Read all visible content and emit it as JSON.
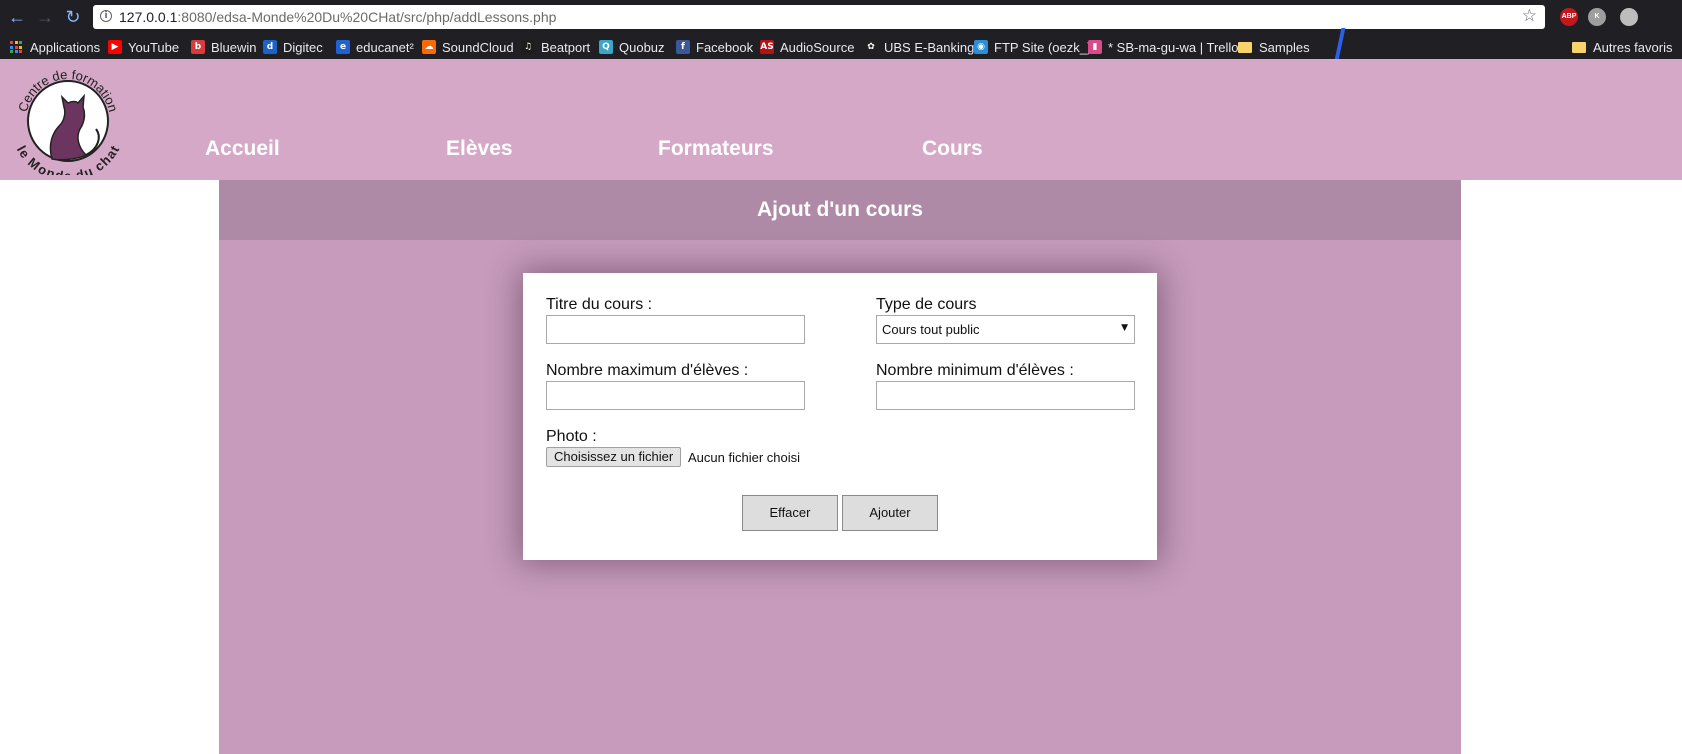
{
  "browser": {
    "url_host": "127.0.0.1",
    "url_rest": ":8080/edsa-Monde%20Du%20CHat/src/php/addLessons.php",
    "info_glyph": "i",
    "extensions": [
      {
        "name": "adblock-plus-icon",
        "text": "ABP",
        "color": "#c4161c"
      },
      {
        "name": "k-extension-icon",
        "text": "K",
        "color": "#9e9e9e"
      },
      {
        "name": "ghost-extension-icon",
        "text": "",
        "color": "#bdbdbd"
      }
    ],
    "bookmarks": [
      {
        "label": "Applications"
      },
      {
        "label": "YouTube",
        "icon": "youtube-icon",
        "color": "#ff0000",
        "glyph": "▶"
      },
      {
        "label": "Bluewin",
        "icon": "bluewin-icon",
        "color": "#d83b3b",
        "glyph": "b"
      },
      {
        "label": "Digitec",
        "icon": "digitec-icon",
        "color": "#1b63c6",
        "glyph": "d"
      },
      {
        "label": "educanet²",
        "icon": "educanet-icon",
        "color": "#1e63d1",
        "glyph": "e"
      },
      {
        "label": "SoundCloud",
        "icon": "soundcloud-icon",
        "color": "#ff6a00",
        "glyph": "☁"
      },
      {
        "label": "Beatport",
        "icon": "beatport-icon",
        "color": "#1d1d1d",
        "glyph": "♫"
      },
      {
        "label": "Quobuz",
        "icon": "quobuz-icon",
        "color": "#3aa5c6",
        "glyph": "Q"
      },
      {
        "label": "Facebook",
        "icon": "facebook-icon",
        "color": "#3b5998",
        "glyph": "f"
      },
      {
        "label": "AudioSource",
        "icon": "audiosource-icon",
        "color": "#b31217",
        "glyph": "AS"
      },
      {
        "label": "UBS E-Banking",
        "icon": "ubs-icon",
        "color": "#202020",
        "glyph": "✿"
      },
      {
        "label": "FTP Site (oezk_)",
        "icon": "ftp-globe-icon",
        "color": "#2a8fd8",
        "glyph": "◉"
      },
      {
        "label": "* SB-ma-gu-wa | Trello",
        "icon": "trello-icon",
        "color": "#d94a8a",
        "glyph": "▮"
      },
      {
        "label": "Samples",
        "icon": "folder-icon"
      }
    ],
    "other_bookmarks": "Autres favoris"
  },
  "site": {
    "logo_text_top": "Centre de formation",
    "logo_text_bottom": "le Monde du chat",
    "nav": [
      "Accueil",
      "Elèves",
      "Formateurs",
      "Cours"
    ]
  },
  "page": {
    "title": "Ajout d'un cours",
    "form": {
      "title_label": "Titre du cours :",
      "title_value": "",
      "type_label": "Type de cours",
      "type_selected": "Cours tout public",
      "max_label": "Nombre maximum d'élèves :",
      "max_value": "",
      "min_label": "Nombre minimum d'élèves :",
      "min_value": "",
      "photo_label": "Photo :",
      "file_button": "Choisissez un fichier",
      "file_status": "Aucun fichier choisi",
      "reset_button": "Effacer",
      "submit_button": "Ajouter"
    }
  }
}
